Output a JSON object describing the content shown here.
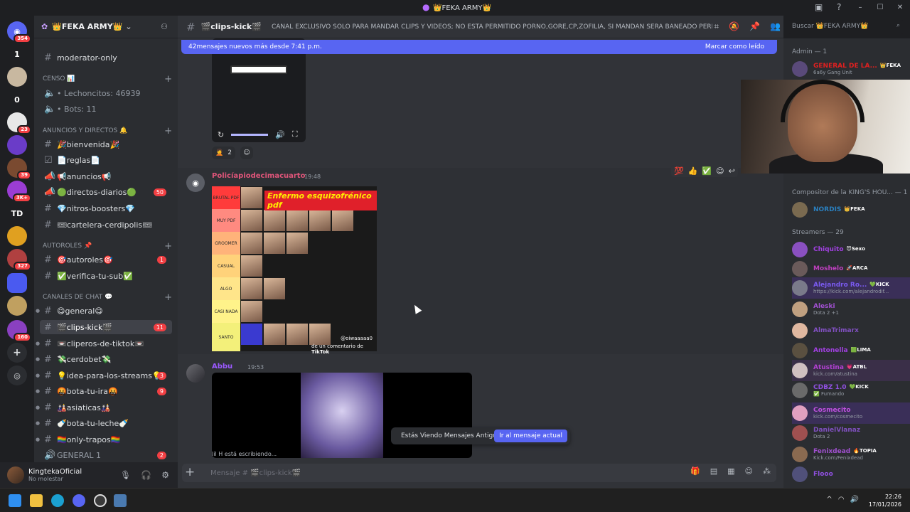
{
  "window": {
    "title": "👑FEKA ARMY👑"
  },
  "server": {
    "name": "👑FEKA ARMY👑"
  },
  "guilds": [
    {
      "label": "354",
      "color": "#5865f2",
      "badge": "354"
    },
    {
      "label": "1",
      "color": "#1e1f22",
      "badge": ""
    },
    {
      "label": "",
      "color": "#c8b8a0",
      "badge": ""
    },
    {
      "label": "0",
      "color": "#1e1f22",
      "badge": ""
    },
    {
      "label": "",
      "color": "#e8e8e8",
      "badge": "23"
    },
    {
      "label": "",
      "color": "#6a3cc8",
      "badge": ""
    },
    {
      "label": "",
      "color": "#7a4a30",
      "badge": "39"
    },
    {
      "label": "",
      "color": "#9b3dd4",
      "badge": "3K+"
    },
    {
      "label": "TD",
      "color": "#1e1f22",
      "badge": ""
    },
    {
      "label": "",
      "color": "#e0a020",
      "badge": ""
    },
    {
      "label": "",
      "color": "#b04040",
      "badge": "327"
    },
    {
      "label": "",
      "color": "#4a5af0",
      "badge": ""
    },
    {
      "label": "",
      "color": "#c0a060",
      "badge": ""
    },
    {
      "label": "",
      "color": "#8a40c0",
      "badge": "160"
    },
    {
      "label": "+",
      "color": "#2b2d31",
      "badge": ""
    },
    {
      "label": "◎",
      "color": "#2b2d31",
      "badge": ""
    }
  ],
  "channels": {
    "moderator": "moderator-only",
    "censo_cat": "CENSO 📊",
    "lechoncitos": "• Lechoncitos: 46939",
    "bots": "• Bots: 11",
    "anuncios_cat": "ANUNCIOS Y DIRECTOS 🔔",
    "bienvenida": "🎉bienvenida🎉",
    "reglas": "📄reglas📄",
    "anuncios": "📢anuncios📢",
    "directos": "🟢directos-diarios🟢",
    "directos_count": "50",
    "nitros": "💎nitros-boosters💎",
    "cartelera": "🎟cartelera-cerdipolis🎟",
    "autoroles_cat": "AUTOROLES 📌",
    "autoroles": "🎯autoroles🎯",
    "autoroles_count": "1",
    "verifica": "✅verifica-tu-sub✅",
    "chat_cat": "CANALES DE CHAT 💬",
    "general": "😋general😋",
    "clips": "🎬clips-kick🎬",
    "clips_count": "11",
    "cliperos": "📼cliperos-de-tiktok📼",
    "cerdobet": "💸cerdobet💸",
    "idea": "💡idea-para-los-streams💡",
    "idea_count": "3",
    "bota_ira": "🤬bota-tu-ira🤬",
    "bota_ira_count": "9",
    "asiaticas": "🎎asiaticas🎎",
    "bota_leche": "🍼bota-tu-leche🍼",
    "trapos": "🏳️‍🌈only-trapos🏳️‍🌈",
    "general1": "GENERAL 1",
    "general1_count": "2"
  },
  "user": {
    "name": "KingtekaOficial",
    "status": "No molestar"
  },
  "header": {
    "channel": "🎬clips-kick🎬",
    "topic": "CANAL EXCLUSIVO SOLO PARA MANDAR CLIPS Y VIDEOS; NO ESTA PERMITIDO PORNO,GORE,CP,ZOFILIA, SI MANDAN SERA BANEADO PERMA...",
    "search_placeholder": "Buscar 👑FEKA ARMY👑"
  },
  "newbar": {
    "text": "42mensajes nuevos más desde 7:41 p.m.",
    "mark": "Marcar como leído"
  },
  "messages": {
    "m1_reaction_count": "2",
    "m2_author": "Policíapiodecimacuarto",
    "m2_time": "19:48",
    "tier_title": "Enfermo esquizofrénico pdf",
    "tier_rows": [
      "BRUTAL PDF",
      "MUY PDF",
      "GROOMER",
      "CASUAL",
      "ALGO",
      "CASI NADA",
      "SANTO"
    ],
    "tier_colors": [
      "#ff3b3b",
      "#ff8a80",
      "#ffb37a",
      "#ffd27a",
      "#ffe58a",
      "#fff38a",
      "#f3f07a"
    ],
    "tier_credit": "@oiwaaaaa0",
    "tier_tiktok": "TikTok",
    "tier_comment": "de un comentario de",
    "m3_author": "Abbu",
    "m3_time": "19:53",
    "typing": "lil H está escribiendo..."
  },
  "pill": {
    "text": "Estás Viendo Mensajes Antiguos",
    "button": "Ir al mensaje actual"
  },
  "input": {
    "placeholder": "Mensaje # 🎬clips-kick🎬"
  },
  "members": {
    "admin_group": "Admin — 1",
    "admin_name": "GENERAL DE LA...",
    "admin_tag": "👑FEKA",
    "admin_status": "6a6y Gang Unit",
    "comp_group": "Compositor de la KING'S HOU... — 1",
    "comp_name": "NORDIS",
    "comp_tag": "👑FEKA",
    "streamers_group": "Streamers — 29",
    "streamers": [
      {
        "name": "Chiquito",
        "tag": "😈Sexo",
        "status": "",
        "color": "#a040e0"
      },
      {
        "name": "Moshelo",
        "tag": "🚀ARCA",
        "status": "",
        "color": "#c040c0"
      },
      {
        "name": "Alejandro Ro...",
        "tag": "💚KICK",
        "status": "https://kick.com/alejandrodif...",
        "color": "#7a5af0"
      },
      {
        "name": "Aleski",
        "tag": "",
        "status": "Dota 2 +1",
        "color": "#a050d0"
      },
      {
        "name": "AlmaTrimarx",
        "tag": "",
        "status": "",
        "color": "#8050c0"
      },
      {
        "name": "Antonella",
        "tag": "🟩LIMA",
        "status": "",
        "color": "#a040e0"
      },
      {
        "name": "Atustina",
        "tag": "💗ATBL",
        "status": "kick.com/atustina",
        "color": "#b040d0"
      },
      {
        "name": "CDBZ 1.0",
        "tag": "💚KICK",
        "status": "✅ Fumando",
        "color": "#9050e0"
      },
      {
        "name": "Cosmecito",
        "tag": "",
        "status": "kick.com/cosmecito",
        "color": "#c050e0"
      },
      {
        "name": "DanielVlanaz",
        "tag": "",
        "status": "Dota 2",
        "color": "#8050c0"
      },
      {
        "name": "Fenixdead",
        "tag": "🔥TOPIA",
        "status": "Kick.com/Fenixdead",
        "color": "#a050d0"
      },
      {
        "name": "Flooo",
        "tag": "",
        "status": "",
        "color": "#9050e0"
      }
    ]
  },
  "taskbar": {
    "time": "22:26",
    "date": "17/01/2026"
  }
}
